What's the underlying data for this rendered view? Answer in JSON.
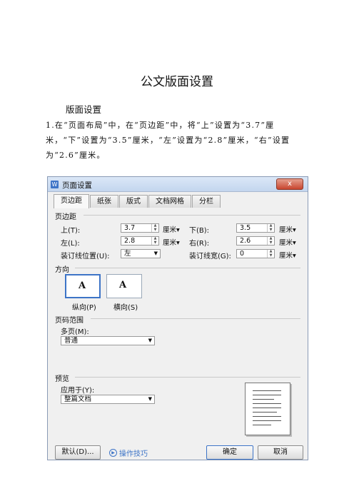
{
  "document": {
    "title": "公文版面设置",
    "heading": "版面设置",
    "paragraph": "1.在“页面布局”中，在“页边距”中，将“上”设置为“3.7”厘米，“下”设置为“3.5”厘米，“左”设置为“2.8”厘米，“右”设置为“2.6”厘米。"
  },
  "dialog": {
    "title": "页面设置",
    "close_label": "x",
    "app_icon": "W",
    "tabs": [
      "页边距",
      "纸张",
      "版式",
      "文档网格",
      "分栏"
    ],
    "active_tab": 0,
    "margins": {
      "section_label": "页边距",
      "top_label": "上(T):",
      "top_value": "3.7",
      "bottom_label": "下(B):",
      "bottom_value": "3.5",
      "left_label": "左(L):",
      "left_value": "2.8",
      "right_label": "右(R):",
      "right_value": "2.6",
      "gutter_pos_label": "装订线位置(U):",
      "gutter_pos_value": "左",
      "gutter_width_label": "装订线宽(G):",
      "gutter_width_value": "0",
      "unit": "厘米"
    },
    "orientation": {
      "section_label": "方向",
      "portrait_label": "纵向(P)",
      "landscape_label": "横向(S)",
      "glyph": "A",
      "selected": "portrait"
    },
    "page_range": {
      "section_label": "页码范围",
      "multi_label": "多页(M):",
      "multi_value": "普通"
    },
    "preview": {
      "section_label": "预览",
      "apply_label": "应用于(Y):",
      "apply_value": "整篇文档"
    },
    "buttons": {
      "default_label": "默认(D)...",
      "tips_label": "操作技巧",
      "ok_label": "确定",
      "cancel_label": "取消"
    }
  }
}
